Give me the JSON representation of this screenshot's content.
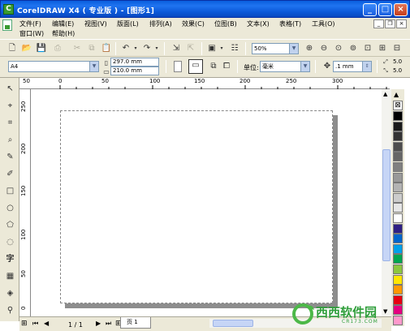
{
  "window": {
    "title": "CorelDRAW X4 ( 专业版 ) - [图形1]"
  },
  "menu": {
    "items": [
      "文件(F)",
      "编辑(E)",
      "视图(V)",
      "版面(L)",
      "排列(A)",
      "效果(C)",
      "位图(B)",
      "文本(X)",
      "表格(T)",
      "工具(O)"
    ],
    "items2": [
      "窗口(W)",
      "帮助(H)"
    ]
  },
  "toolbar": {
    "zoom": "50%"
  },
  "propbar": {
    "paper": "A4",
    "width": "297.0 mm",
    "height": "210.0 mm",
    "unit_label": "单位:",
    "unit": "毫米",
    "nudge": ".1 mm",
    "dup1": "5.0",
    "dup2": "5.0"
  },
  "hruler_labels": [
    "50",
    "0",
    "50",
    "100",
    "150",
    "200",
    "250",
    "300"
  ],
  "vruler_labels": [
    "250",
    "200",
    "150",
    "100",
    "50",
    "0"
  ],
  "statusbar": {
    "page_count": "1 / 1",
    "page_tab": "页 1"
  },
  "palette_colors": [
    "#000000",
    "#1a1a1a",
    "#333333",
    "#4d4d4d",
    "#666666",
    "#808080",
    "#999999",
    "#b3b3b3",
    "#cccccc",
    "#e6e6e6",
    "#ffffff",
    "#2e1f84",
    "#0066cc",
    "#00a0e9",
    "#00a650",
    "#8dc63f",
    "#ffe600",
    "#ff9900",
    "#e60012",
    "#e4007f",
    "#ff99cc"
  ],
  "watermark": {
    "brand": "西西软件园",
    "url": "CR173.COM"
  }
}
